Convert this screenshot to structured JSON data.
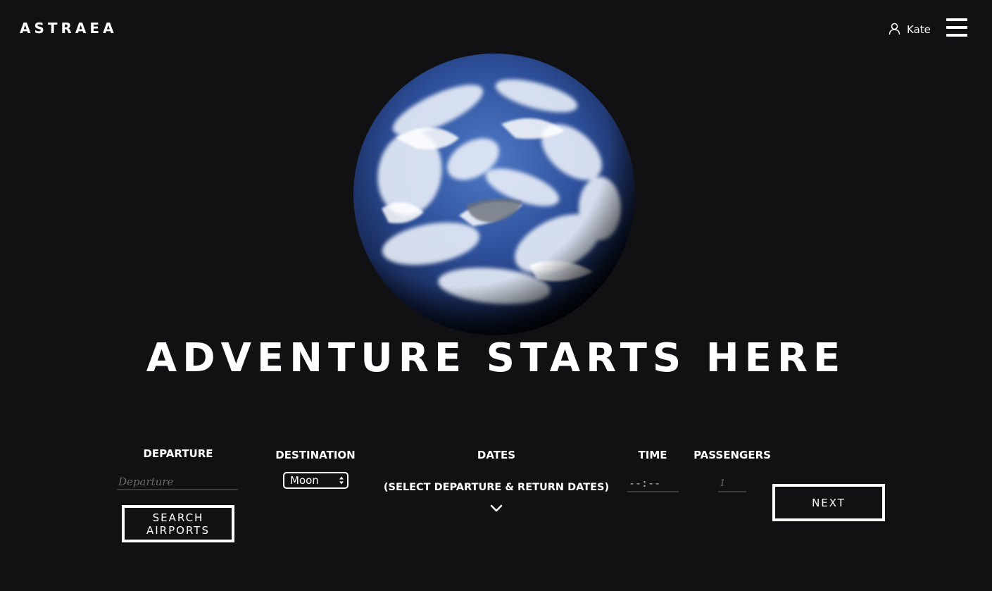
{
  "header": {
    "logo": "ASTRAEA",
    "user_icon": "user-icon",
    "user_name": "Kate",
    "menu_icon": "hamburger-menu-icon"
  },
  "hero": {
    "image": "earth-globe",
    "title": "ADVENTURE STARTS HERE"
  },
  "booking": {
    "departure": {
      "label": "DEPARTURE",
      "placeholder": "Departure",
      "value": "",
      "search_button": "SEARCH AIRPORTS"
    },
    "destination": {
      "label": "DESTINATION",
      "selected": "Moon"
    },
    "dates": {
      "label": "DATES",
      "prompt": "(SELECT DEPARTURE & RETURN DATES)",
      "icon": "chevron-down-icon"
    },
    "time": {
      "label": "TIME",
      "value": "--:--"
    },
    "passengers": {
      "label": "PASSENGERS",
      "placeholder": "1"
    },
    "next_button": "NEXT"
  },
  "colors": {
    "background": "#111013",
    "text": "#ffffff",
    "placeholder": "#6b6a70",
    "input_underline": "#3a3a3d"
  }
}
